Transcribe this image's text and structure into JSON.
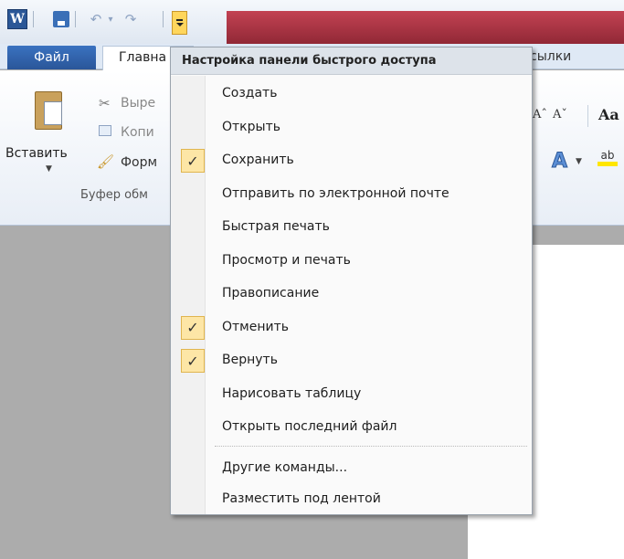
{
  "qat": {
    "app_icon_label": "W",
    "undo_glyph": "↶",
    "dropdown_glyph": "▾",
    "redo_glyph": "↷"
  },
  "ribbon": {
    "file_tab": "Файл",
    "home_tab": "Главна",
    "refs_tab": "сылки",
    "clipboard": {
      "paste": "Вставить",
      "cut": "Выре",
      "copy": "Копи",
      "format": "Форм",
      "group": "Буфер обм"
    },
    "font": {
      "grow": "Aˆ",
      "shrink": "Aˇ",
      "change_case": "Aa",
      "text_effect": "A",
      "highlight": "ab"
    }
  },
  "menu": {
    "title": "Настройка панели быстрого доступа",
    "check_glyph": "✓",
    "items": [
      {
        "label": "Создать",
        "checked": false
      },
      {
        "label": "Открыть",
        "checked": false
      },
      {
        "label": "Сохранить",
        "checked": true
      },
      {
        "label": "Отправить по электронной почте",
        "checked": false
      },
      {
        "label": "Быстрая печать",
        "checked": false
      },
      {
        "label": "Просмотр и печать",
        "checked": false
      },
      {
        "label": "Правописание",
        "checked": false
      },
      {
        "label": "Отменить",
        "checked": true
      },
      {
        "label": "Вернуть",
        "checked": true
      },
      {
        "label": "Нарисовать таблицу",
        "checked": false
      },
      {
        "label": "Открыть последний файл",
        "checked": false
      }
    ],
    "more_commands": "Другие команды...",
    "show_below": "Разместить под лентой"
  },
  "colors": {
    "accent_blue": "#2b5797",
    "check_highlight": "#fde6a6",
    "title_red": "#a82a3a"
  }
}
